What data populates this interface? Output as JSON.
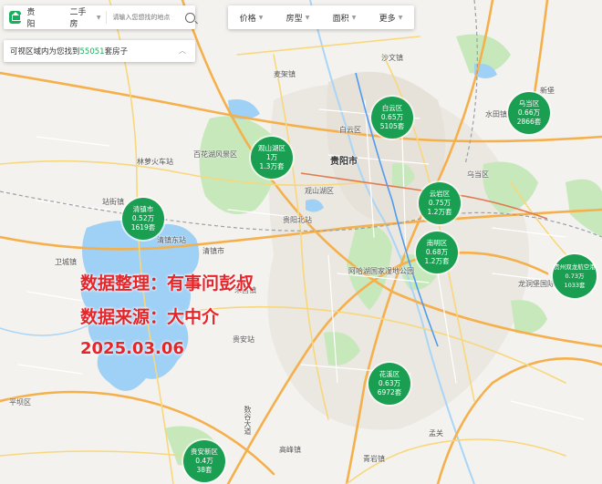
{
  "header": {
    "city": "贵阳",
    "listing_type": "二手房",
    "search_placeholder": "请输入您想找的地点"
  },
  "result": {
    "prefix": "可视区域内为您找到",
    "count": "55051",
    "suffix": "套房子"
  },
  "filters": [
    "价格",
    "房型",
    "面积",
    "更多"
  ],
  "districts": [
    {
      "name": "白云区",
      "price": "0.65万",
      "count": "5105套"
    },
    {
      "name": "乌当区",
      "price": "0.66万",
      "count": "2866套"
    },
    {
      "name": "观山湖区",
      "price": "1万",
      "count": "1.3万套"
    },
    {
      "name": "清镇市",
      "price": "0.52万",
      "count": "1619套"
    },
    {
      "name": "云岩区",
      "price": "0.75万",
      "count": "1.2万套"
    },
    {
      "name": "南明区",
      "price": "0.68万",
      "count": "1.2万套"
    },
    {
      "name": "贵州双龙航空港",
      "price": "0.73万",
      "count": "1033套"
    },
    {
      "name": "花溪区",
      "price": "0.63万",
      "count": "6972套"
    },
    {
      "name": "贵安新区",
      "price": "0.4万",
      "count": "38套"
    }
  ],
  "places": [
    "贵阳市",
    "白云区",
    "观山湖区",
    "乌当区",
    "清镇市",
    "平坝区",
    "贵阳北站",
    "林萝火车站",
    "数谷大道",
    "孟关",
    "贵安站",
    "清镇东站",
    "朱昌镇",
    "龙洞堡国际机场",
    "百花湖风景区",
    "阿哈湖国家湿地公园",
    "卫城镇",
    "站街镇",
    "麦架镇",
    "沙文镇",
    "新堡",
    "水田镇",
    "高峰镇",
    "青岩镇"
  ],
  "watermark": {
    "line1": "数据整理：有事问彭叔",
    "line2": "数据来源：大中介",
    "line3": "2025.03.06"
  },
  "colors": {
    "bubble": "#1a9e52",
    "accent": "#18b05c",
    "watermark": "#e5252a",
    "water": "#9fd0f5",
    "park": "#b9e3b1"
  }
}
